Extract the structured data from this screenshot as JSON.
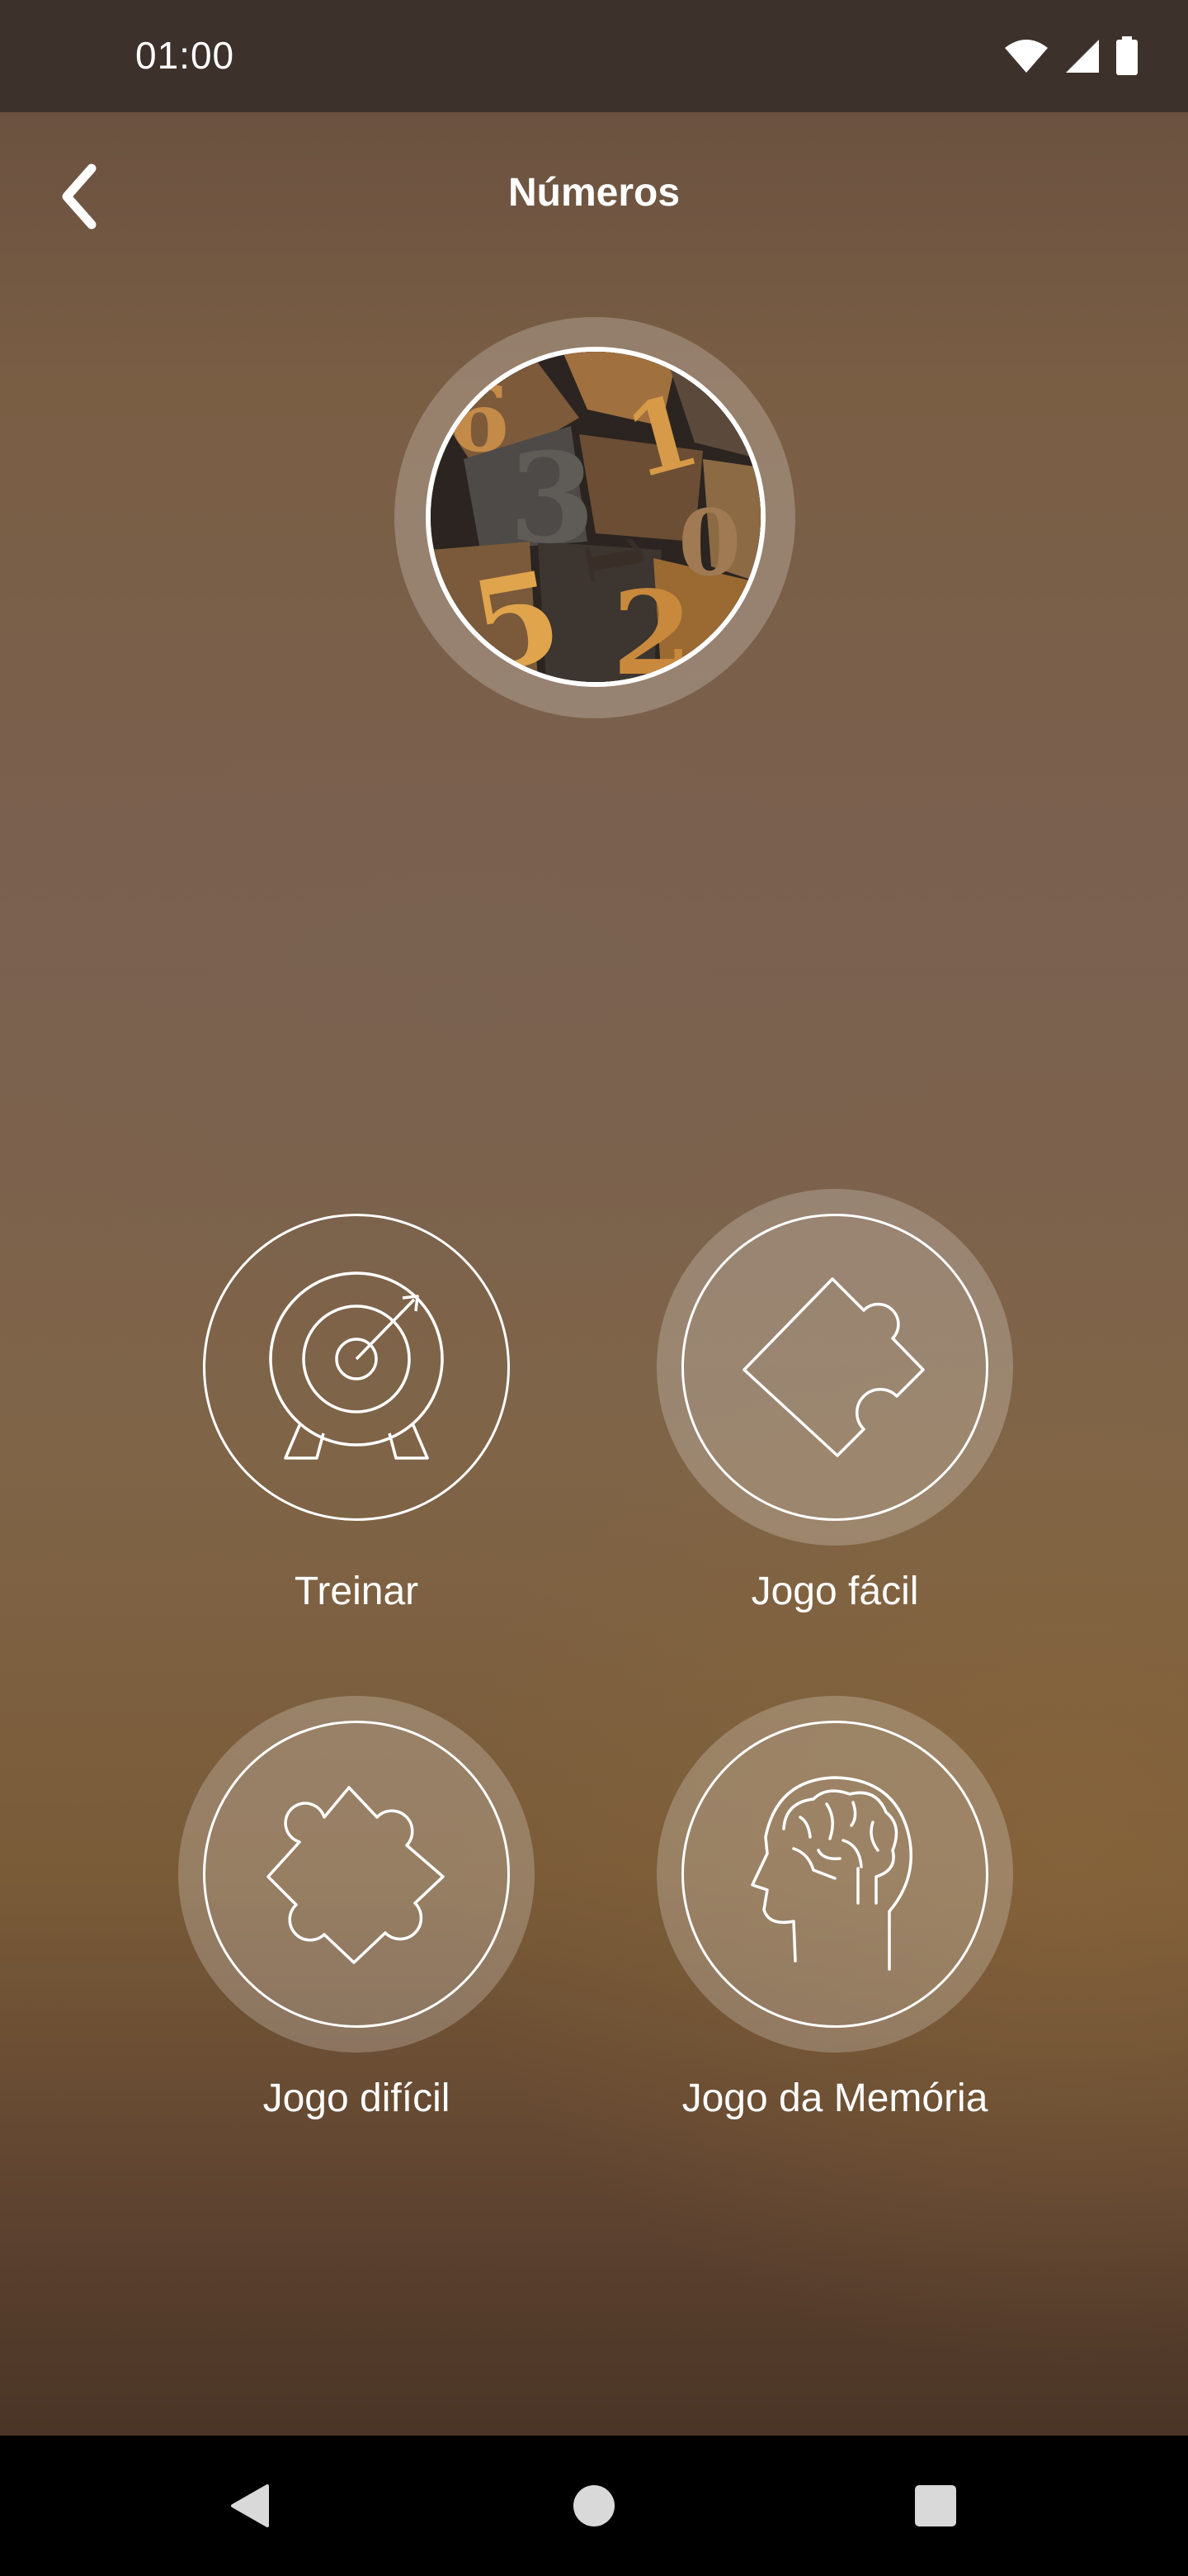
{
  "status_bar": {
    "time": "01:00",
    "icons": [
      "wifi-icon",
      "cellular-signal-icon",
      "battery-icon"
    ]
  },
  "app_bar": {
    "title": "Números",
    "back_icon": "chevron-left-icon"
  },
  "hero": {
    "image": "wooden-letterpress-numbers-photo"
  },
  "modes": [
    {
      "label": "Treinar",
      "icon": "archery-target-icon"
    },
    {
      "label": "Jogo fácil",
      "icon": "puzzle-piece-icon"
    },
    {
      "label": "Jogo difícil",
      "icon": "puzzle-piece-icon"
    },
    {
      "label": "Jogo da Memória",
      "icon": "head-brain-icon"
    }
  ],
  "nav_bar": {
    "icons": [
      "back-triangle-icon",
      "home-circle-icon",
      "recents-square-icon"
    ]
  },
  "colors": {
    "status_bar": "#3d322b",
    "nav_bar": "#000000",
    "accent": "#ffffff"
  }
}
